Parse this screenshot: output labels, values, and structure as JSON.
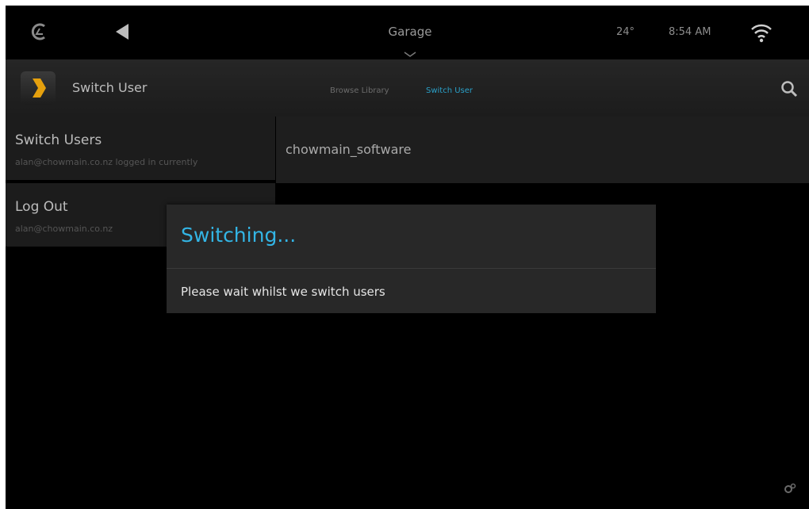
{
  "status_bar": {
    "logo_icon": "control4-logo-icon",
    "back_icon": "back-arrow-icon",
    "room": "Garage",
    "room_chevron_icon": "chevron-down-icon",
    "temperature": "24°",
    "time": "8:54 AM",
    "wifi_icon": "wifi-icon"
  },
  "action_bar": {
    "app_icon": "plex-chevron-icon",
    "title": "Switch User",
    "tabs": [
      {
        "label": "Browse Library",
        "active": false
      },
      {
        "label": "Switch User",
        "active": true
      }
    ],
    "search_icon": "search-icon"
  },
  "menu": {
    "items": [
      {
        "title": "Switch Users",
        "subtitle": "alan@chowmain.co.nz logged in currently"
      },
      {
        "title": "Log Out",
        "subtitle": "alan@chowmain.co.nz"
      }
    ]
  },
  "content": {
    "account": "chowmain_software"
  },
  "dialog": {
    "title": "Switching...",
    "message": "Please wait whilst we switch users"
  },
  "colors": {
    "accent": "#33b5e5",
    "tab_active": "#2aa0c8",
    "plex_orange": "#e5a00d"
  }
}
